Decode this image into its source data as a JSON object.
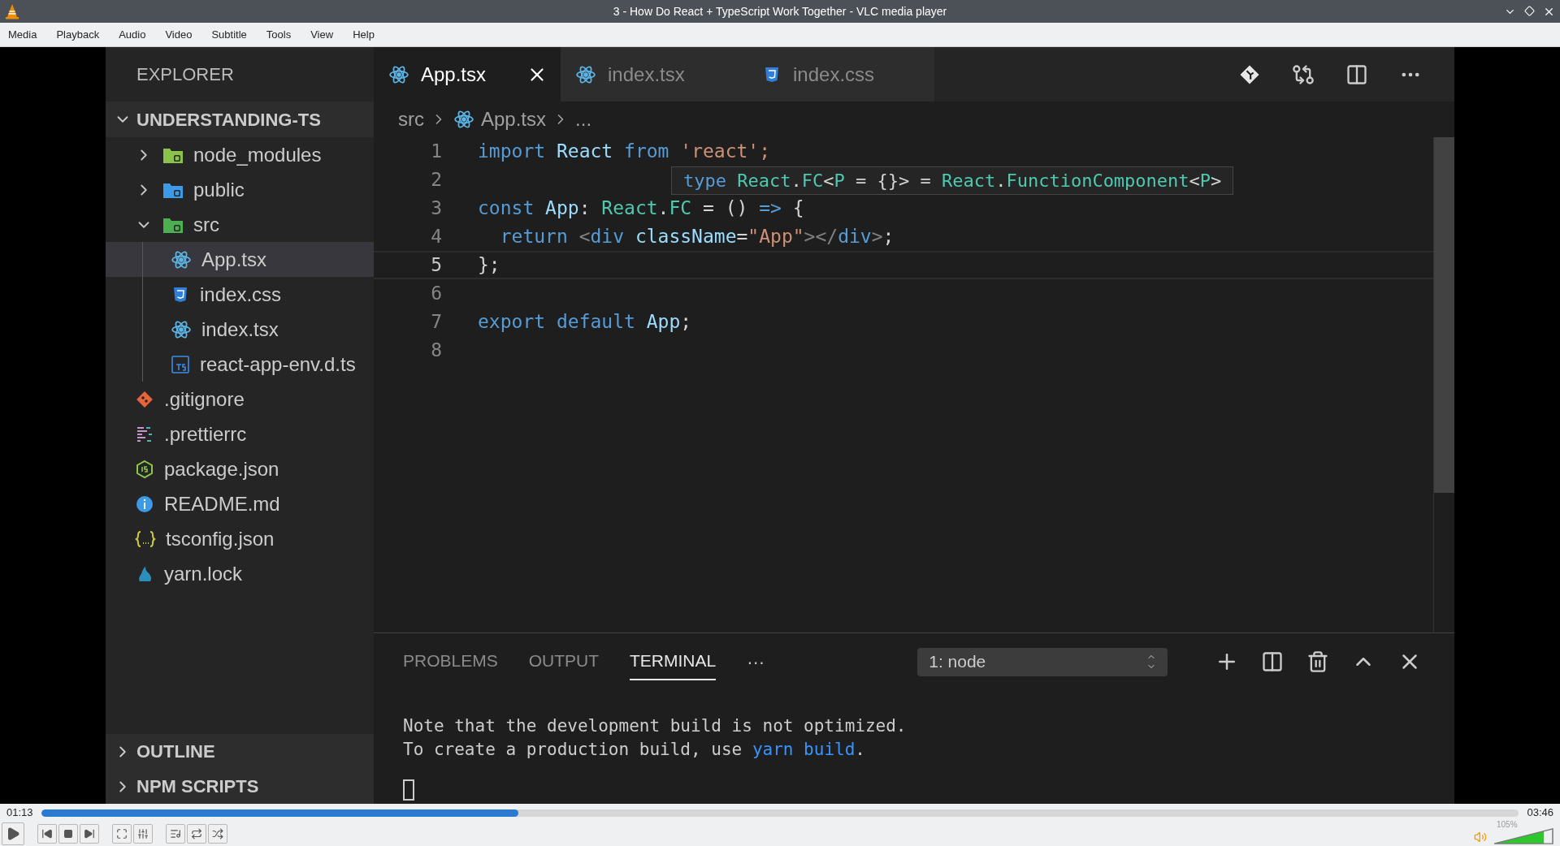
{
  "window": {
    "title": "3 - How Do React + TypeScript Work Together - VLC media player"
  },
  "menu": [
    "Media",
    "Playback",
    "Audio",
    "Video",
    "Subtitle",
    "Tools",
    "View",
    "Help"
  ],
  "editor": {
    "explorer": {
      "title": "EXPLORER",
      "root": {
        "label": "UNDERSTANDING-TS",
        "expanded": true,
        "children": [
          {
            "label": "node_modules",
            "kind": "folder-node",
            "expanded": false,
            "selected": false
          },
          {
            "label": "public",
            "kind": "folder-public",
            "expanded": false,
            "selected": false
          },
          {
            "label": "src",
            "kind": "folder-src",
            "expanded": true,
            "selected": false,
            "children": [
              {
                "label": "App.tsx",
                "kind": "react",
                "selected": true
              },
              {
                "label": "index.css",
                "kind": "css",
                "selected": false
              },
              {
                "label": "index.tsx",
                "kind": "react",
                "selected": false
              },
              {
                "label": "react-app-env.d.ts",
                "kind": "ts",
                "selected": false
              }
            ]
          },
          {
            "label": ".gitignore",
            "kind": "git",
            "selected": false
          },
          {
            "label": ".prettierrc",
            "kind": "prettier",
            "selected": false
          },
          {
            "label": "package.json",
            "kind": "node",
            "selected": false
          },
          {
            "label": "README.md",
            "kind": "info",
            "selected": false
          },
          {
            "label": "tsconfig.json",
            "kind": "json",
            "selected": false
          },
          {
            "label": "yarn.lock",
            "kind": "yarn",
            "selected": false
          }
        ]
      },
      "sections": [
        {
          "label": "OUTLINE",
          "expanded": false
        },
        {
          "label": "NPM SCRIPTS",
          "expanded": false
        }
      ]
    },
    "tabs": [
      {
        "label": "App.tsx",
        "kind": "react",
        "selected": true
      },
      {
        "label": "index.tsx",
        "kind": "react",
        "selected": false
      },
      {
        "label": "index.css",
        "kind": "css",
        "selected": false
      }
    ],
    "breadcrumb": [
      {
        "label": "src",
        "kind": "folder"
      },
      {
        "label": "App.tsx",
        "kind": "react"
      },
      {
        "label": "...",
        "kind": "more"
      }
    ],
    "code": [
      {
        "number": "1",
        "current": false,
        "tokens": [
          {
            "text": "import ",
            "kind": "keyword"
          },
          {
            "text": "React ",
            "kind": "variable"
          },
          {
            "text": "from ",
            "kind": "keyword"
          },
          {
            "text": "'react';",
            "kind": "string"
          }
        ]
      },
      {
        "number": "2",
        "current": false
      },
      {
        "number": "3",
        "current": false,
        "tokens": [
          {
            "text": "const ",
            "kind": "keyword"
          },
          {
            "text": "App",
            "kind": "variable"
          },
          {
            "text": ": ",
            "kind": "punct"
          },
          {
            "text": "React",
            "kind": "type"
          },
          {
            "text": ".",
            "kind": "punct"
          },
          {
            "text": "FC",
            "kind": "type"
          },
          {
            "text": " = () ",
            "kind": "punct"
          },
          {
            "text": "=>",
            "kind": "keyword"
          },
          {
            "text": " {",
            "kind": "punct"
          }
        ]
      },
      {
        "number": "4",
        "current": false,
        "tokens": [
          {
            "text": "  return ",
            "kind": "keyword"
          },
          {
            "text": "<",
            "kind": "tag"
          },
          {
            "text": "div ",
            "kind": "keyword"
          },
          {
            "text": "className",
            "kind": "variable"
          },
          {
            "text": "=",
            "kind": "punct"
          },
          {
            "text": "\"App\"",
            "kind": "string"
          },
          {
            "text": "></",
            "kind": "tag"
          },
          {
            "text": "div",
            "kind": "keyword"
          },
          {
            "text": ">",
            "kind": "tag"
          },
          {
            "text": ";",
            "kind": "punct"
          }
        ]
      },
      {
        "number": "5",
        "current": true,
        "tokens": [
          {
            "text": "};",
            "kind": "punct"
          }
        ]
      },
      {
        "number": "6",
        "current": false
      },
      {
        "number": "7",
        "current": false,
        "tokens": [
          {
            "text": "export ",
            "kind": "keyword"
          },
          {
            "text": "default ",
            "kind": "keyword"
          },
          {
            "text": "App",
            "kind": "variable"
          },
          {
            "text": ";",
            "kind": "punct"
          }
        ]
      },
      {
        "number": "8",
        "current": false
      }
    ],
    "tooltip": [
      {
        "text": "type ",
        "kind": "keyword"
      },
      {
        "text": "React",
        "kind": "type"
      },
      {
        "text": ".",
        "kind": "punct"
      },
      {
        "text": "FC",
        "kind": "type"
      },
      {
        "text": "<",
        "kind": "punct"
      },
      {
        "text": "P",
        "kind": "type"
      },
      {
        "text": " = {}> = ",
        "kind": "punct"
      },
      {
        "text": "React",
        "kind": "type"
      },
      {
        "text": ".",
        "kind": "punct"
      },
      {
        "text": "FunctionComponent",
        "kind": "type"
      },
      {
        "text": "<",
        "kind": "punct"
      },
      {
        "text": "P",
        "kind": "type"
      },
      {
        "text": ">",
        "kind": "punct"
      }
    ],
    "panel": {
      "tabs": [
        {
          "label": "PROBLEMS",
          "selected": false
        },
        {
          "label": "OUTPUT",
          "selected": false
        },
        {
          "label": "TERMINAL",
          "selected": true
        }
      ],
      "more": "···",
      "terminal": "1: node",
      "lines": [
        [
          {
            "text": "Note that the development build is not optimized.",
            "kind": "plain"
          }
        ],
        [
          {
            "text": "To create a production build, use ",
            "kind": "plain"
          },
          {
            "text": "yarn build",
            "kind": "link"
          },
          {
            "text": ".",
            "kind": "plain"
          }
        ]
      ]
    }
  },
  "player": {
    "elapsed": "01:13",
    "seek": {
      "level": 0.323
    },
    "total": "03:46",
    "volume": {
      "reading": "105%",
      "level": 0.84
    }
  }
}
